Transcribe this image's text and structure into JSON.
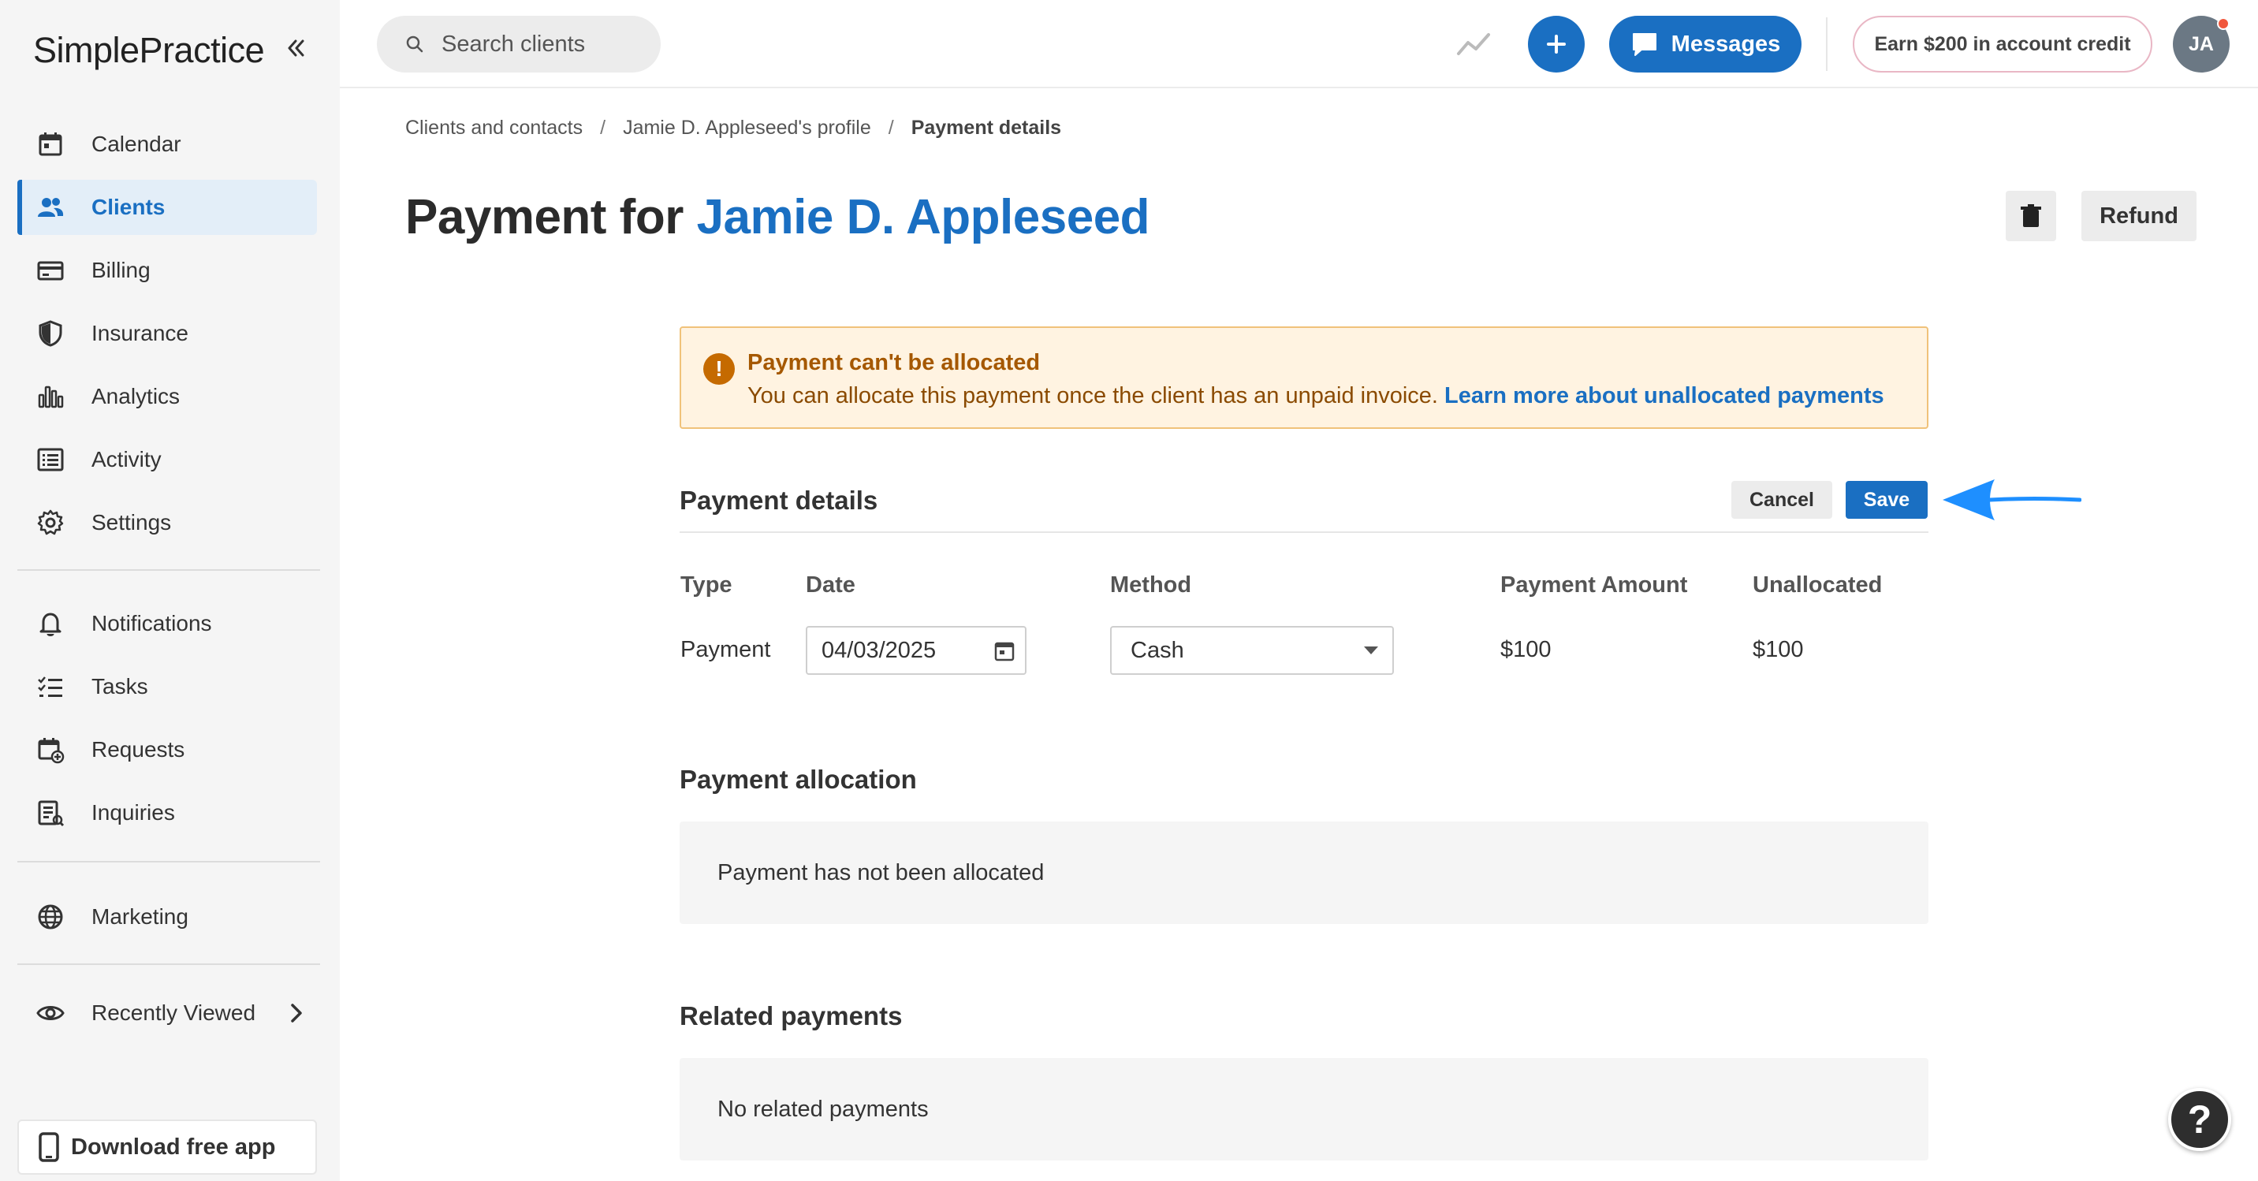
{
  "app": {
    "logo": "SimplePractice"
  },
  "sidebar": {
    "items": [
      {
        "label": "Calendar",
        "icon": "calendar-icon"
      },
      {
        "label": "Clients",
        "icon": "users-icon",
        "active": true
      },
      {
        "label": "Billing",
        "icon": "credit-card-icon"
      },
      {
        "label": "Insurance",
        "icon": "shield-icon"
      },
      {
        "label": "Analytics",
        "icon": "bar-chart-icon"
      },
      {
        "label": "Activity",
        "icon": "list-icon"
      },
      {
        "label": "Settings",
        "icon": "gear-icon"
      },
      {
        "label": "Notifications",
        "icon": "bell-icon"
      },
      {
        "label": "Tasks",
        "icon": "checklist-icon"
      },
      {
        "label": "Requests",
        "icon": "calendar-add-icon"
      },
      {
        "label": "Inquiries",
        "icon": "inquiry-icon"
      },
      {
        "label": "Marketing",
        "icon": "globe-icon"
      },
      {
        "label": "Recently Viewed",
        "icon": "eye-icon"
      }
    ],
    "download_app": "Download free app"
  },
  "topbar": {
    "search_placeholder": "Search clients",
    "messages_label": "Messages",
    "earn_label": "Earn $200 in account credit",
    "avatar_initials": "JA"
  },
  "breadcrumb": {
    "items": [
      "Clients and contacts",
      "Jamie D. Appleseed's profile",
      "Payment details"
    ]
  },
  "page": {
    "title_prefix": "Payment for",
    "client_name": "Jamie D. Appleseed",
    "refund_label": "Refund"
  },
  "alert": {
    "title": "Payment can't be allocated",
    "text": "You can allocate this payment once the client has an unpaid invoice.",
    "link": "Learn more about unallocated payments"
  },
  "payment_details": {
    "title": "Payment details",
    "cancel_label": "Cancel",
    "save_label": "Save",
    "columns": [
      "Type",
      "Date",
      "Method",
      "Payment Amount",
      "Unallocated"
    ],
    "row": {
      "type": "Payment",
      "date": "04/03/2025",
      "method": "Cash",
      "amount": "$100",
      "unallocated": "$100"
    }
  },
  "allocation": {
    "title": "Payment allocation",
    "empty": "Payment has not been allocated"
  },
  "related": {
    "title": "Related payments",
    "empty": "No related payments"
  },
  "help_label": "?",
  "colors": {
    "accent": "#1a6fc2",
    "alert_bg": "#fff3e1",
    "alert_text": "#a55800",
    "arrow": "#1e8fff"
  }
}
